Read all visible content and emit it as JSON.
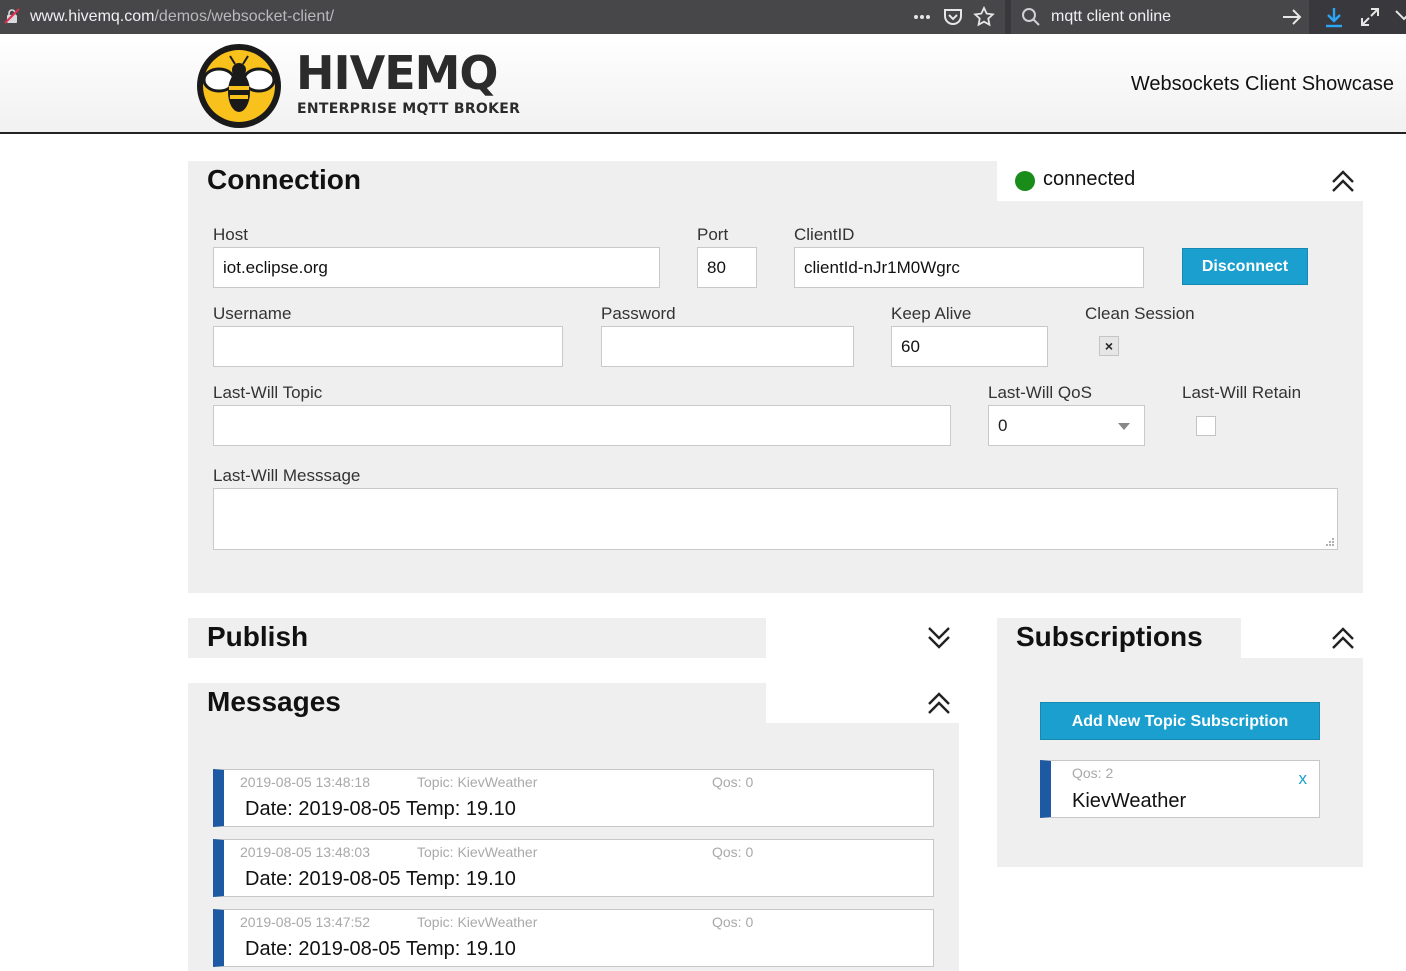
{
  "browser": {
    "url_domain": "www.hivemq.com",
    "url_path": "/demos/websocket-client/",
    "search_query": "mqtt client online"
  },
  "header": {
    "logo_title": "HIVEMQ",
    "logo_tagline": "ENTERPRISE MQTT BROKER",
    "showcase_title": "Websockets Client Showcase"
  },
  "connection": {
    "title": "Connection",
    "status": "connected",
    "status_color": "#1a8c1a",
    "host_label": "Host",
    "host_value": "iot.eclipse.org",
    "port_label": "Port",
    "port_value": "80",
    "clientid_label": "ClientID",
    "clientid_value": "clientId-nJr1M0Wgrc",
    "disconnect_label": "Disconnect",
    "username_label": "Username",
    "username_value": "",
    "password_label": "Password",
    "password_value": "",
    "keepalive_label": "Keep Alive",
    "keepalive_value": "60",
    "clean_session_label": "Clean Session",
    "clean_session_mark": "×",
    "lastwill_topic_label": "Last-Will Topic",
    "lastwill_topic_value": "",
    "lastwill_qos_label": "Last-Will QoS",
    "lastwill_qos_value": "0",
    "lastwill_retain_label": "Last-Will Retain",
    "lastwill_message_label": "Last-Will Messsage"
  },
  "publish": {
    "title": "Publish"
  },
  "messages": {
    "title": "Messages",
    "items": [
      {
        "time": "2019-08-05 13:48:18",
        "topic": "Topic: KievWeather",
        "qos": "Qos: 0",
        "body": "Date: 2019-08-05 Temp: 19.10"
      },
      {
        "time": "2019-08-05 13:48:03",
        "topic": "Topic: KievWeather",
        "qos": "Qos: 0",
        "body": "Date: 2019-08-05 Temp: 19.10"
      },
      {
        "time": "2019-08-05 13:47:52",
        "topic": "Topic: KievWeather",
        "qos": "Qos: 0",
        "body": "Date: 2019-08-05 Temp: 19.10"
      }
    ]
  },
  "subscriptions": {
    "title": "Subscriptions",
    "add_label": "Add New Topic Subscription",
    "items": [
      {
        "qos": "Qos: 2",
        "topic": "KievWeather",
        "remove": "x"
      }
    ]
  },
  "colors": {
    "accent": "#1a9fce",
    "card_stripe": "#1d5aa3",
    "panel_bg": "#efefef",
    "logo_yellow": "#f8c11c"
  }
}
